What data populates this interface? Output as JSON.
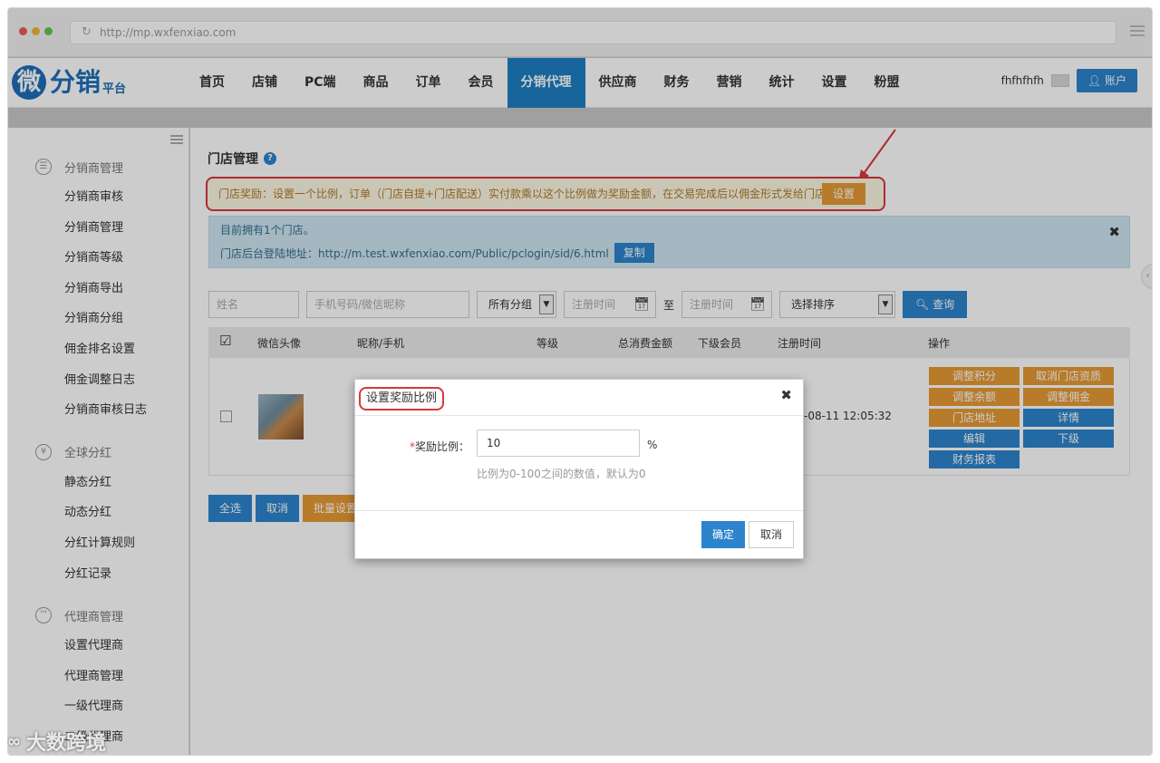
{
  "browser": {
    "url": "http://mp.wxfenxiao.com"
  },
  "logo": {
    "mark": "微",
    "main": "分销",
    "sub": "平台"
  },
  "nav": {
    "items": [
      "首页",
      "店铺",
      "PC端",
      "商品",
      "订单",
      "会员",
      "分销代理",
      "供应商",
      "财务",
      "营销",
      "统计",
      "设置",
      "粉盟"
    ],
    "active_index": 6,
    "username": "fhfhfhfh",
    "account_label": "账户"
  },
  "sidebar": {
    "groups": [
      {
        "title": "分销商管理",
        "items": [
          "分销商审核",
          "分销商管理",
          "分销商等级",
          "分销商导出",
          "分销商分组",
          "佣金排名设置",
          "佣金调整日志",
          "分销商审核日志"
        ]
      },
      {
        "title": "全球分红",
        "items": [
          "静态分红",
          "动态分红",
          "分红计算规则",
          "分红记录"
        ]
      },
      {
        "title": "代理商管理",
        "items": [
          "设置代理商",
          "代理商管理",
          "一级代理商",
          "二级代理商"
        ]
      }
    ]
  },
  "page": {
    "title": "门店管理",
    "warn_text": "门店奖励：设置一个比例，订单（门店自提+门店配送）实付款乘以这个比例做为奖励金额，在交易完成后以佣金形式发给门店",
    "warn_button": "设置",
    "info_line1": "目前拥有1个门店。",
    "info_line2": "门店后台登陆地址：http://m.test.wxfenxiao.com/Public/pclogin/sid/6.html",
    "copy_button": "复制"
  },
  "filters": {
    "name_placeholder": "姓名",
    "phone_placeholder": "手机号码/微信昵称",
    "group_select": "所有分组",
    "date_from_placeholder": "注册时间",
    "to_label": "至",
    "date_to_placeholder": "注册时间",
    "sort_select": "选择排序",
    "search_button": "查询"
  },
  "table": {
    "headers": [
      "微信头像",
      "昵称/手机",
      "等级",
      "总消费金额",
      "下级会员",
      "注册时间",
      "操作"
    ],
    "row": {
      "reg_time": "-08-11 12:05:32",
      "actions": [
        "调整积分",
        "取消门店资质",
        "调整余额",
        "调整佣金",
        "门店地址",
        "详情",
        "编辑",
        "下级",
        "财务报表"
      ]
    }
  },
  "bulk": {
    "select_all": "全选",
    "cancel": "取消",
    "batch": "批量设置"
  },
  "modal": {
    "title": "设置奖励比例",
    "field_label": "奖励比例：",
    "required_mark": "*",
    "value": "10",
    "unit": "%",
    "hint": "比例为0-100之间的数值，默认为0",
    "ok": "确定",
    "cancel": "取消"
  },
  "watermark": {
    "text": "大数跨境"
  },
  "colors": {
    "primary": "#2c84cc",
    "warning": "#e69a35",
    "annotation": "#d9363e",
    "info_bg": "#cfe5f0"
  }
}
